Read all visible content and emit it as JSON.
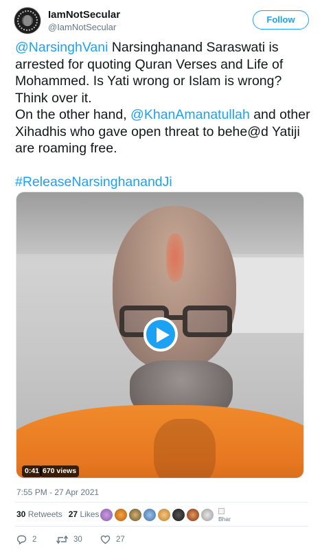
{
  "account": {
    "display_name": "IamNotSecular",
    "handle": "@IamNotSecular",
    "follow_label": "Follow"
  },
  "tweet": {
    "mention1": "@NarsinghVani",
    "line1_rest": " Narsinghanand Saraswati is arrested for quoting Quran Verses and Life of Mohammed. Is Yati wrong or Islam is wrong? Think over it.",
    "line2_pre": "On the other hand, ",
    "mention2": "@KhanAmanatullah",
    "line2_post": " and other Xihadhis who gave open threat to behe@d Yatiji are roaming free.",
    "hashtag": "#ReleaseNarsinghanandJi"
  },
  "video": {
    "duration": "0:41",
    "views": "670 views"
  },
  "timestamp": "7:55 PM - 27 Apr 2021",
  "stats": {
    "retweets_count": "30",
    "retweets_label": "Retweets",
    "likes_count": "27",
    "likes_label": "Likes"
  },
  "likers_overflow_text": "Bhar",
  "actions": {
    "reply_count": "2",
    "retweet_count": "30",
    "like_count": "27"
  },
  "colors": {
    "accent": "#1da1f2",
    "text_primary": "#14171a",
    "text_secondary": "#657786"
  },
  "icons": {
    "play": "play-icon",
    "reply": "reply-icon",
    "retweet": "retweet-icon",
    "like": "heart-icon"
  }
}
